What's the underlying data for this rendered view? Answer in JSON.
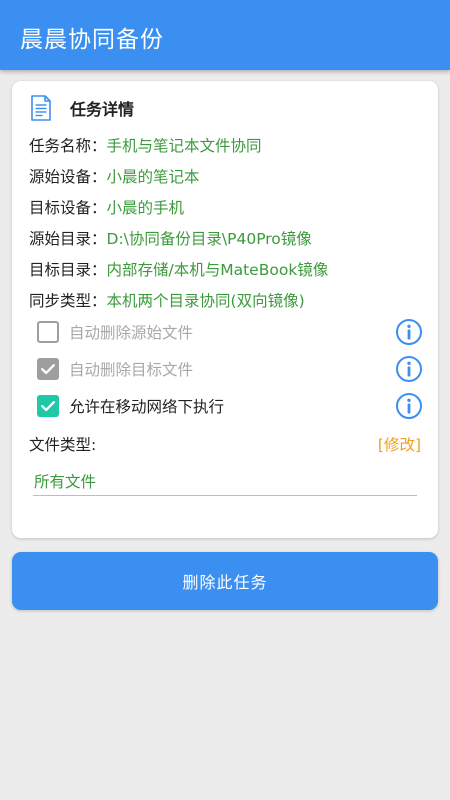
{
  "app": {
    "title": "晨晨协同备份"
  },
  "card": {
    "title": "任务详情",
    "icon": "document-icon",
    "fields": [
      {
        "label": "任务名称：",
        "value": "手机与笔记本文件协同"
      },
      {
        "label": "源始设备：",
        "value": "小晨的笔记本"
      },
      {
        "label": "目标设备：",
        "value": "小晨的手机"
      },
      {
        "label": "源始目录：",
        "value": "D:\\协同备份目录\\P40Pro镜像"
      },
      {
        "label": "目标目录：",
        "value": "内部存储/本机与MateBook镜像"
      },
      {
        "label": "同步类型：",
        "value": "本机两个目录协同(双向镜像)"
      }
    ],
    "options": [
      {
        "label": "自动删除源始文件",
        "checked": false,
        "enabled": false
      },
      {
        "label": "自动删除目标文件",
        "checked": true,
        "enabled": false
      },
      {
        "label": "允许在移动网络下执行",
        "checked": true,
        "enabled": true
      }
    ],
    "file_type": {
      "label": "文件类型:",
      "modify_label": "[修改]",
      "value": "所有文件"
    }
  },
  "actions": {
    "delete_label": "删除此任务"
  },
  "colors": {
    "primary": "#3b8ff0",
    "value_green": "#3c9a3c",
    "accent_orange": "#f0a020",
    "check_teal": "#1fc9a8",
    "disabled_gray": "#9e9e9e"
  }
}
